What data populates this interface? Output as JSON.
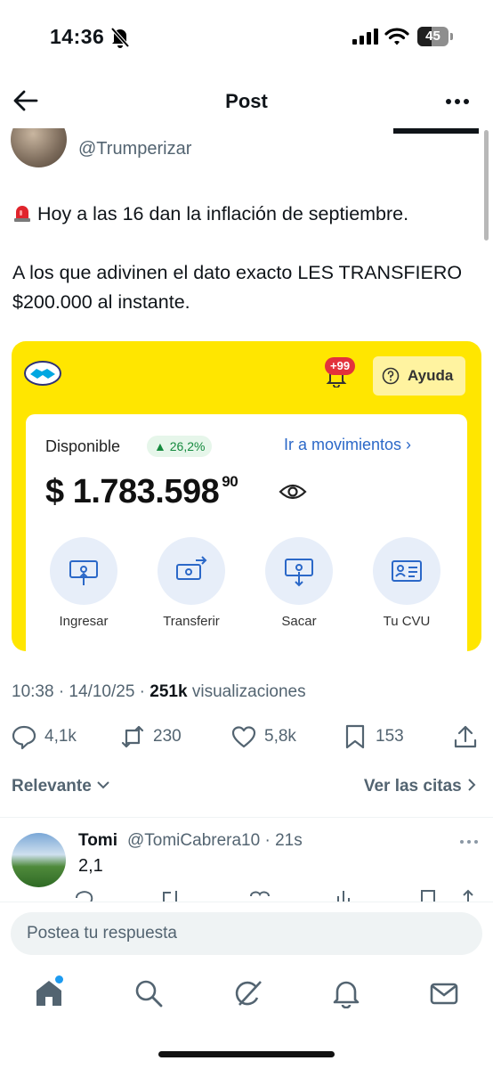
{
  "status_bar": {
    "time": "14:36",
    "battery": "45",
    "battery_level": 0.45
  },
  "header": {
    "title": "Post"
  },
  "tweet": {
    "author_handle": "@Trumperizar",
    "lines": [
      "Hoy a las 16 dan la inflación de septiembre.",
      "A los que adivinen el dato exacto LES TRANSFIERO $200.000 al instante."
    ],
    "timestamp": "10:38 · 14/10/25 · ",
    "views_count": "251k",
    "views_label": " visualizaciones",
    "stats": {
      "replies": "4,1k",
      "reposts": "230",
      "likes": "5,8k",
      "bookmarks": "153"
    }
  },
  "media": {
    "badge": "+99",
    "help_label": "Ayuda",
    "available_label": "Disponible",
    "growth": "▲ 26,2%",
    "movements_link": "Ir a movimientos ›",
    "balance": "$ 1.783.598",
    "balance_cents": "90",
    "actions": [
      {
        "label": "Ingresar"
      },
      {
        "label": "Transferir"
      },
      {
        "label": "Sacar"
      },
      {
        "label": "Tu CVU"
      }
    ]
  },
  "sort": {
    "relevance_label": "Relevante",
    "quotes_label": "Ver las citas"
  },
  "reply": {
    "name": "Tomi",
    "handle_time": "@TomiCabrera10 · 21s",
    "text": "2,1"
  },
  "composer": {
    "placeholder": "Postea tu respuesta"
  },
  "icons": {
    "colors": {
      "text": "#0f1419",
      "muted": "#536471",
      "accent": "#1d9bf0",
      "mp_yellow": "#ffe600",
      "mp_blue": "#2b68c8"
    }
  }
}
